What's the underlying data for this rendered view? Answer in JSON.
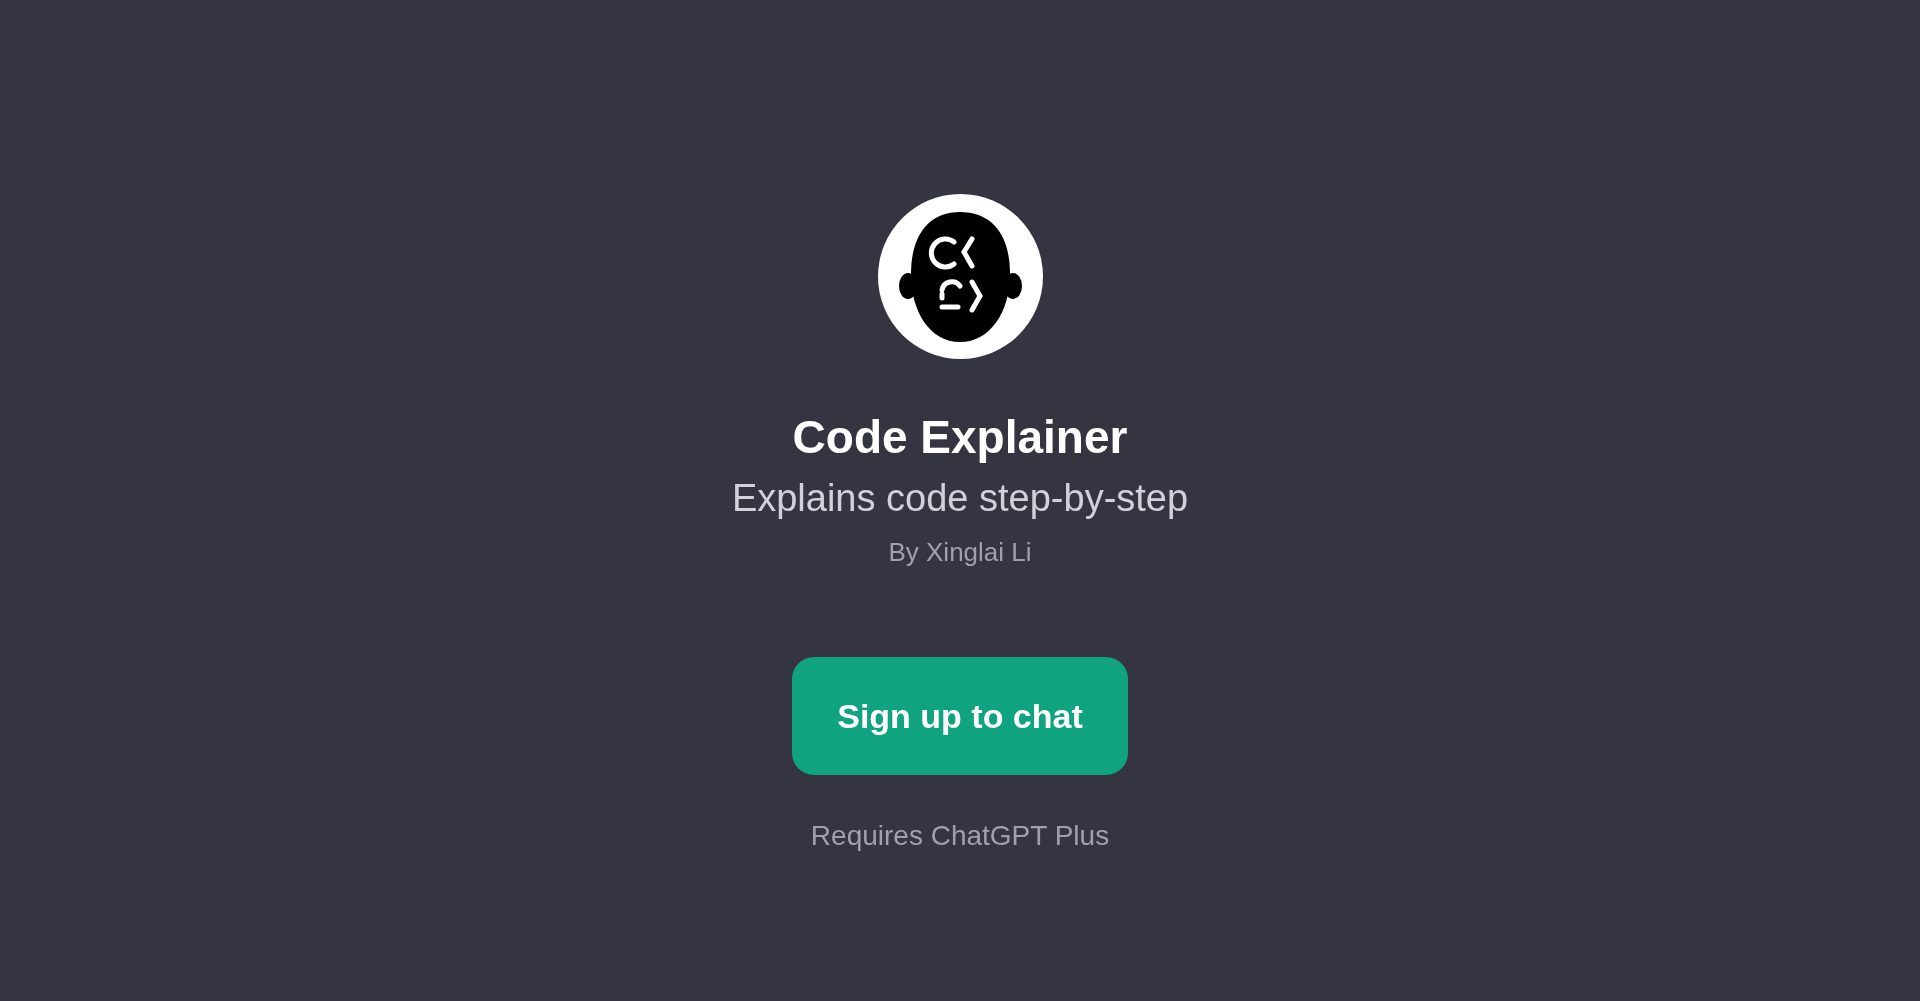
{
  "gpt": {
    "name": "Code Explainer",
    "description": "Explains code step-by-step",
    "author": "By Xinglai Li"
  },
  "cta": {
    "label": "Sign up to chat"
  },
  "note": "Requires ChatGPT Plus"
}
